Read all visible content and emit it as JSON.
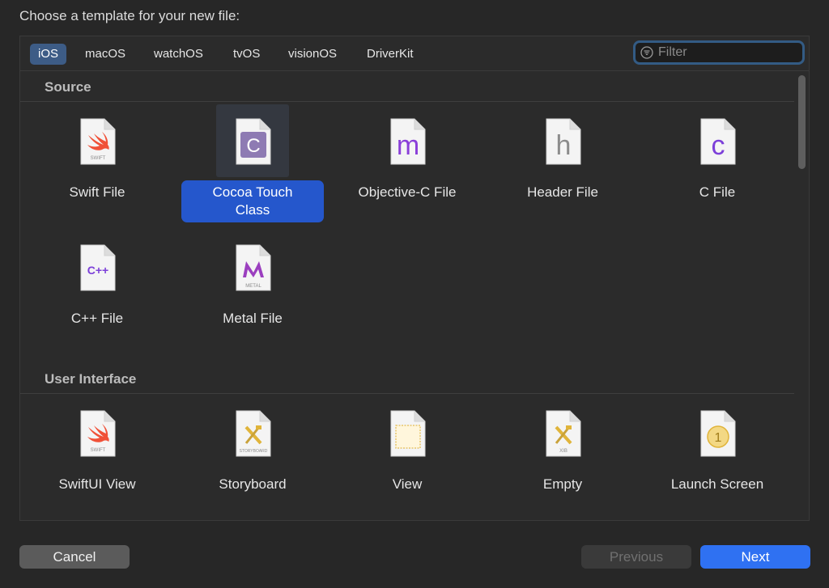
{
  "dialog": {
    "title": "Choose a template for your new file:"
  },
  "tabs": [
    "iOS",
    "macOS",
    "watchOS",
    "tvOS",
    "visionOS",
    "DriverKit"
  ],
  "filter": {
    "placeholder": "Filter",
    "value": ""
  },
  "sections": [
    {
      "title": "Source",
      "items": [
        {
          "label": "Swift File",
          "glyph": "",
          "sub": "SWIFT",
          "icon": "swift-file-icon",
          "color": "#f05138"
        },
        {
          "label": "Cocoa Touch Class",
          "glyph": "C",
          "sub": "",
          "icon": "cocoa-touch-class-icon",
          "color": "#8e7bb3",
          "selected": true
        },
        {
          "label": "Objective-C File",
          "glyph": "m",
          "sub": "",
          "icon": "objective-c-file-icon",
          "color": "#8a3fd9"
        },
        {
          "label": "Header File",
          "glyph": "h",
          "sub": "",
          "icon": "header-file-icon",
          "color": "#8c8c8c"
        },
        {
          "label": "C File",
          "glyph": "c",
          "sub": "",
          "icon": "c-file-icon",
          "color": "#7c3fd9"
        },
        {
          "label": "C++ File",
          "glyph": "C++",
          "sub": "",
          "icon": "cpp-file-icon",
          "color": "#7c3fd9"
        },
        {
          "label": "Metal File",
          "glyph": "",
          "sub": "METAL",
          "icon": "metal-file-icon",
          "color": "#9b3fbf"
        }
      ]
    },
    {
      "title": "User Interface",
      "items": [
        {
          "label": "SwiftUI View",
          "glyph": "",
          "sub": "SWIFT",
          "icon": "swiftui-view-icon",
          "color": "#f05138"
        },
        {
          "label": "Storyboard",
          "glyph": "",
          "sub": "STORYBOARD",
          "icon": "storyboard-icon",
          "color": "#e0b43a"
        },
        {
          "label": "View",
          "glyph": "",
          "sub": "",
          "icon": "view-icon",
          "color": "#e8c569"
        },
        {
          "label": "Empty",
          "glyph": "",
          "sub": "XIB",
          "icon": "empty-xib-icon",
          "color": "#e0b43a"
        },
        {
          "label": "Launch Screen",
          "glyph": "1",
          "sub": "",
          "icon": "launch-screen-icon",
          "color": "#e0b43a"
        }
      ]
    }
  ],
  "buttons": {
    "cancel": "Cancel",
    "previous": "Previous",
    "next": "Next"
  }
}
